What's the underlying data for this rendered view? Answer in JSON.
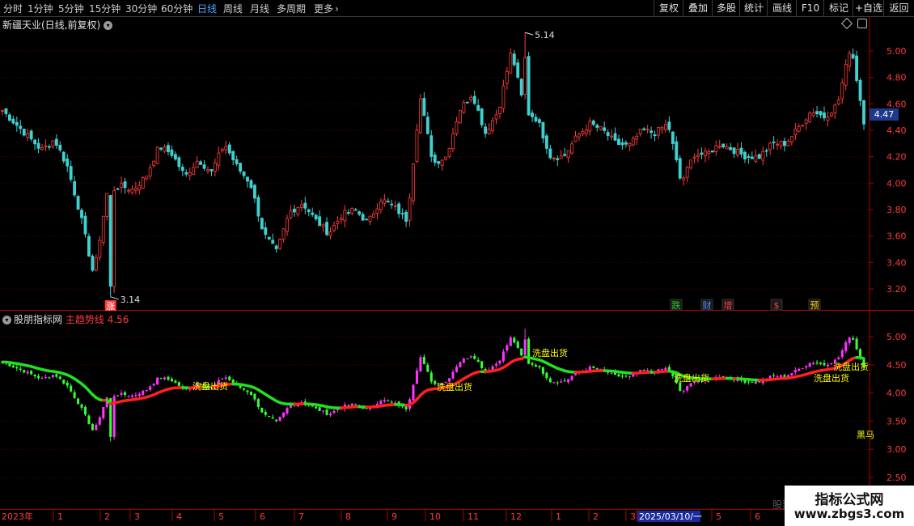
{
  "toolbar": {
    "timeframes": [
      "分时",
      "1分钟",
      "5分钟",
      "15分钟",
      "30分钟",
      "60分钟",
      "日线",
      "周线",
      "月线",
      "多周期"
    ],
    "active_timeframe": "日线",
    "more_label": "更多",
    "more_icon": "chevron-right-icon",
    "right_buttons": [
      "复权",
      "叠加",
      "多股",
      "统计",
      "画线",
      "F10",
      "标记",
      "+自选",
      "返回"
    ]
  },
  "main_chart": {
    "title": "新疆天业(日线,前复权)",
    "title_icon": "chevron-down-icon",
    "corner_icons": [
      "diamond-icon",
      "panel-toggle-icon"
    ],
    "y_ticks": [
      "5.00",
      "4.80",
      "4.60",
      "4.40",
      "4.20",
      "4.00",
      "3.80",
      "3.60",
      "3.40",
      "3.20"
    ],
    "last_price": "4.47",
    "high_label": "5.14",
    "low_label": "3.14",
    "low_marker": "涨",
    "event_markers": [
      {
        "text": "跌",
        "color": "#22cc22"
      },
      {
        "text": "财",
        "color": "#4f8cff"
      },
      {
        "text": "增",
        "color": "#ff3b3b"
      },
      {
        "text": "$",
        "color": "#ff3b3b"
      },
      {
        "text": "预",
        "color": "#ffcc00"
      }
    ]
  },
  "indicator_chart": {
    "name": "股朋指标网",
    "line_label": "主趋势线",
    "line_value": "4.56",
    "title_icon": "chevron-down-icon",
    "y_ticks": [
      "5.00",
      "4.50",
      "4.00",
      "3.50",
      "3.00",
      "2.50"
    ],
    "signal_label": "洗盘出货",
    "edge_label": "黑马"
  },
  "date_axis": {
    "labels": [
      "2023年",
      "1",
      "2",
      "3",
      "4",
      "5",
      "6",
      "7",
      "8",
      "9",
      "10",
      "11",
      "12",
      "1",
      "2",
      "3",
      "2025/03/10/一",
      "5",
      "6"
    ],
    "highlight": "2025/03/10/一"
  },
  "watermark": {
    "title": "指标公式网",
    "url": "www.zbgs3.com",
    "faint": "股票"
  },
  "colors": {
    "up": "#ff3b3b",
    "down": "#3fd0d0",
    "trend_up": "#ff2020",
    "trend_down": "#22e022",
    "candle_up_ind": "#ff33ff",
    "candle_down_ind": "#33ff33",
    "axis": "#b00000",
    "grid": "#5a0000",
    "signal": "#ffff00",
    "highlight_bg": "#1a2a9a"
  },
  "chart_data": {
    "type": "candlestick",
    "ylim": [
      3.1,
      5.2
    ],
    "x": [
      "2023年",
      "1",
      "2",
      "3",
      "4",
      "5",
      "6",
      "7",
      "8",
      "9",
      "10",
      "11",
      "12",
      "1",
      "2",
      "3",
      "2025/03/10/一",
      "5",
      "6"
    ],
    "close_path": [
      4.55,
      4.45,
      4.35,
      4.25,
      4.33,
      4.12,
      3.75,
      3.3,
      3.92,
      3.98,
      3.95,
      4.05,
      4.28,
      4.22,
      4.05,
      4.18,
      4.08,
      4.3,
      4.12,
      4.0,
      3.62,
      3.48,
      3.78,
      3.85,
      3.72,
      3.62,
      3.76,
      3.8,
      3.7,
      3.88,
      3.82,
      3.72,
      4.65,
      4.15,
      4.2,
      4.55,
      4.68,
      4.38,
      4.55,
      5.0,
      4.55,
      4.48,
      4.2,
      4.2,
      4.35,
      4.45,
      4.4,
      4.3,
      4.28,
      4.4,
      4.38,
      4.45,
      4.0,
      4.22,
      4.22,
      4.3,
      4.25,
      4.2,
      4.2,
      4.3,
      4.3,
      4.42,
      4.55,
      4.5,
      4.6,
      5.05,
      4.47
    ],
    "high": 5.14,
    "low": 3.14,
    "last": 4.47,
    "indicator_value": 4.56
  }
}
